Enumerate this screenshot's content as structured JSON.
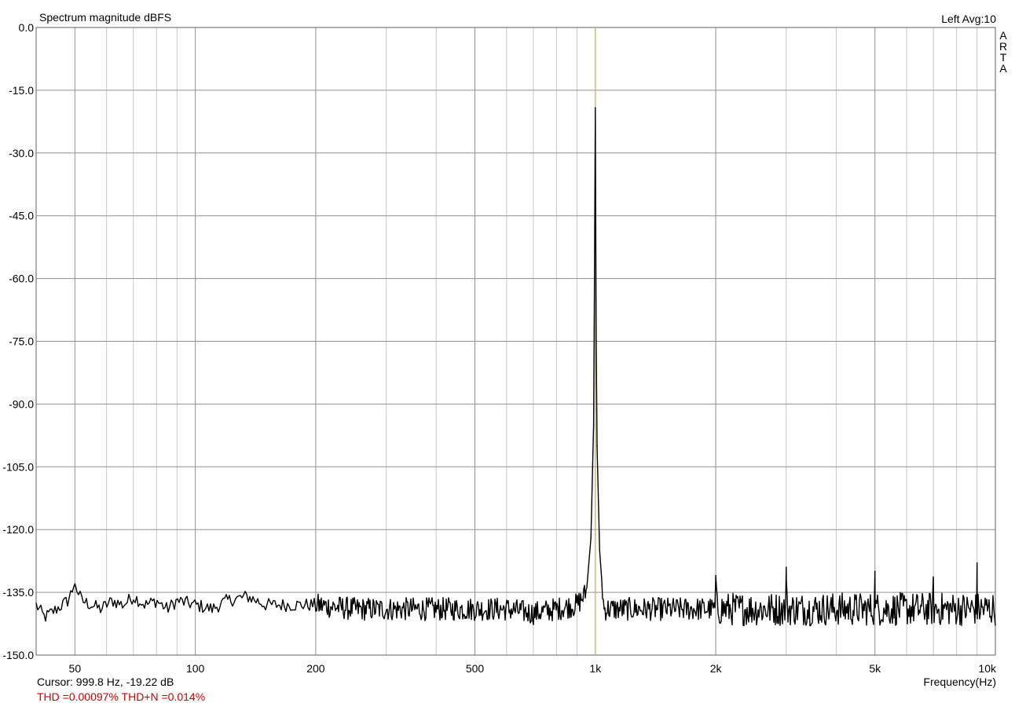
{
  "chart_data": {
    "type": "line",
    "title": "Spectrum magnitude dBFS",
    "channel_info": "Left  Avg:10",
    "brand_letters": [
      "A",
      "R",
      "T",
      "A"
    ],
    "xlabel": "Frequency(Hz)",
    "ylabel": "",
    "x_scale": "log",
    "xlim": [
      40,
      10000
    ],
    "ylim": [
      -150,
      0
    ],
    "y_ticks": [
      0,
      -15,
      -30,
      -45,
      -60,
      -75,
      -90,
      -105,
      -120,
      -135,
      -150
    ],
    "y_tick_labels": [
      "0.0",
      "-15.0",
      "-30.0",
      "-45.0",
      "-60.0",
      "-75.0",
      "-90.0",
      "-105.0",
      "-120.0",
      "-135.0",
      "-150.0"
    ],
    "x_ticks": [
      50,
      100,
      200,
      500,
      1000,
      2000,
      5000,
      10000
    ],
    "x_tick_labels": [
      "50",
      "100",
      "200",
      "500",
      "1k",
      "2k",
      "5k",
      "10k"
    ],
    "minor_x_grid": [
      40,
      60,
      70,
      80,
      90,
      300,
      400,
      600,
      700,
      800,
      900,
      3000,
      4000,
      6000,
      7000,
      8000,
      9000
    ],
    "grid": true,
    "cursor": {
      "frequency": 999.8,
      "level": -19.22,
      "label": "Cursor:   999.8 Hz, -19.22 dB",
      "color": "#c8c800"
    },
    "thd_text": "THD =0.00097%   THD+N =0.014%",
    "series": [
      {
        "color": "#000000",
        "x": [
          40,
          42,
          45,
          48,
          50,
          52,
          55,
          58,
          62,
          66,
          70,
          75,
          80,
          85,
          90,
          100,
          110,
          120,
          135,
          150,
          170,
          200,
          250,
          300,
          400,
          500,
          600,
          700,
          800,
          900,
          950,
          975,
          990,
          995,
          999.8,
          1005,
          1010,
          1025,
          1050,
          1100,
          1200,
          1500,
          1990,
          2000,
          2010,
          2500,
          2990,
          3000,
          3010,
          4000,
          4990,
          5000,
          5010,
          6000,
          6990,
          7000,
          7010,
          8000,
          8990,
          9000,
          9010,
          10000
        ],
        "y": [
          -138,
          -141,
          -139,
          -137,
          -133,
          -137,
          -138,
          -139,
          -137,
          -138,
          -136,
          -138,
          -137,
          -139,
          -137,
          -138,
          -139,
          -137,
          -136,
          -138,
          -138,
          -138,
          -139,
          -139,
          -139,
          -139,
          -139,
          -140,
          -139,
          -138,
          -135,
          -122,
          -95,
          -60,
          -19.22,
          -75,
          -100,
          -125,
          -139,
          -139,
          -139,
          -139,
          -139,
          -131,
          -139,
          -139,
          -139,
          -129,
          -139,
          -139,
          -139,
          -130,
          -139,
          -139,
          -139,
          -132,
          -139,
          -139,
          -139,
          -128,
          -139,
          -139
        ]
      }
    ]
  }
}
